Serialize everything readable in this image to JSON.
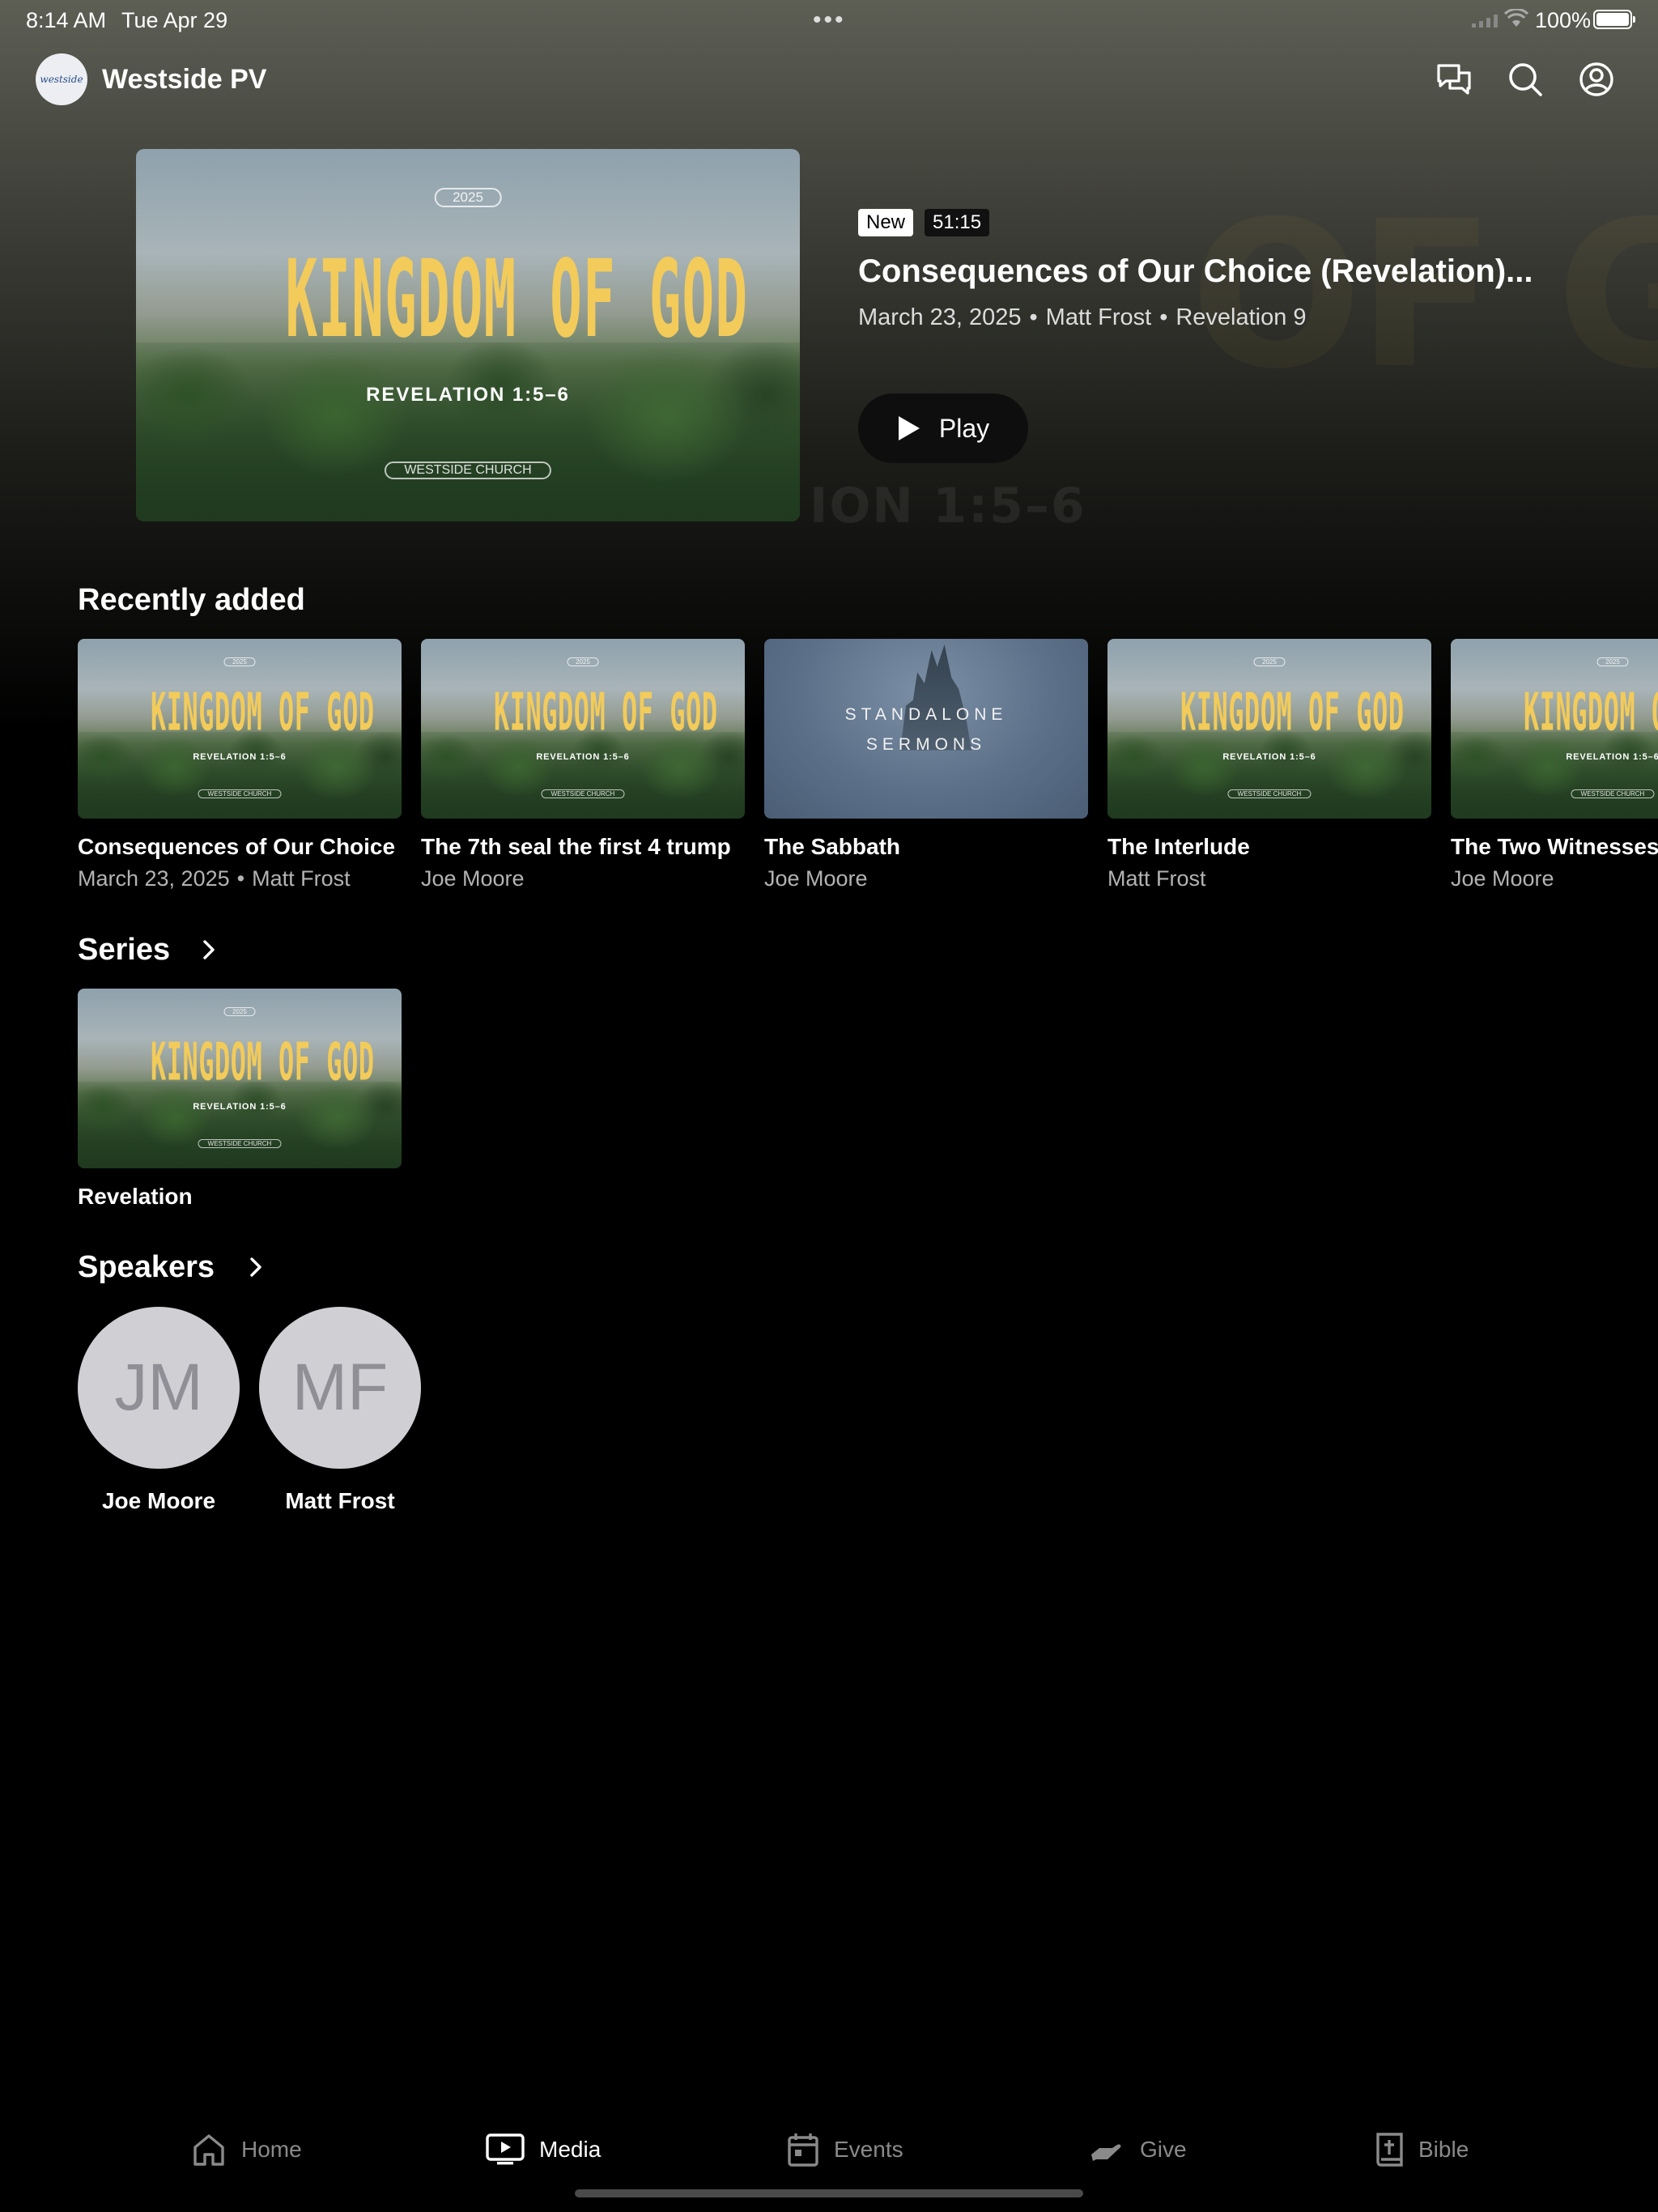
{
  "status_bar": {
    "time": "8:14 AM",
    "date": "Tue Apr 29",
    "battery": "100%"
  },
  "header": {
    "logo_text": "westside",
    "app_name": "Westside PV",
    "icons": [
      "chat-icon",
      "search-icon",
      "account-icon"
    ]
  },
  "featured": {
    "badge_new": "New",
    "duration": "51:15",
    "title": "Consequences of Our Choice (Revelation)...",
    "date": "March 23, 2025",
    "speaker": "Matt Frost",
    "passage": "Revelation 9",
    "play_label": "Play",
    "art": {
      "year": "2025",
      "title": "KINGDOM OF GOD",
      "subtitle": "REVELATION 1:5–6",
      "church": "WESTSIDE CHURCH",
      "bg_ghost": "OF GOD",
      "bg_ghost_sub": "ION 1:5–6"
    }
  },
  "recently_added": {
    "title": "Recently added",
    "items": [
      {
        "title": "Consequences of Our Choice",
        "date": "March 23, 2025",
        "speaker": "Matt Frost"
      },
      {
        "title": "The 7th seal the first 4 trump",
        "speaker": "Joe Moore"
      },
      {
        "title": "The Sabbath",
        "speaker": "Joe Moore",
        "art_label_1": "STANDALONE",
        "art_label_2": "SERMONS"
      },
      {
        "title": "The Interlude",
        "speaker": "Matt Frost"
      },
      {
        "title": "The Two Witnesses",
        "speaker": "Joe Moore"
      }
    ]
  },
  "series": {
    "title": "Series",
    "items": [
      {
        "title": "Revelation"
      }
    ]
  },
  "speakers": {
    "title": "Speakers",
    "items": [
      {
        "initials": "JM",
        "name": "Joe Moore"
      },
      {
        "initials": "MF",
        "name": "Matt Frost"
      }
    ]
  },
  "tabs": [
    {
      "label": "Home",
      "icon": "home-icon",
      "active": false
    },
    {
      "label": "Media",
      "icon": "media-icon",
      "active": true
    },
    {
      "label": "Events",
      "icon": "calendar-icon",
      "active": false
    },
    {
      "label": "Give",
      "icon": "give-icon",
      "active": false
    },
    {
      "label": "Bible",
      "icon": "bible-icon",
      "active": false
    }
  ],
  "colors": {
    "accent_title": "#f2cb5a",
    "background": "#000000",
    "avatar": "#cfcfd4"
  }
}
